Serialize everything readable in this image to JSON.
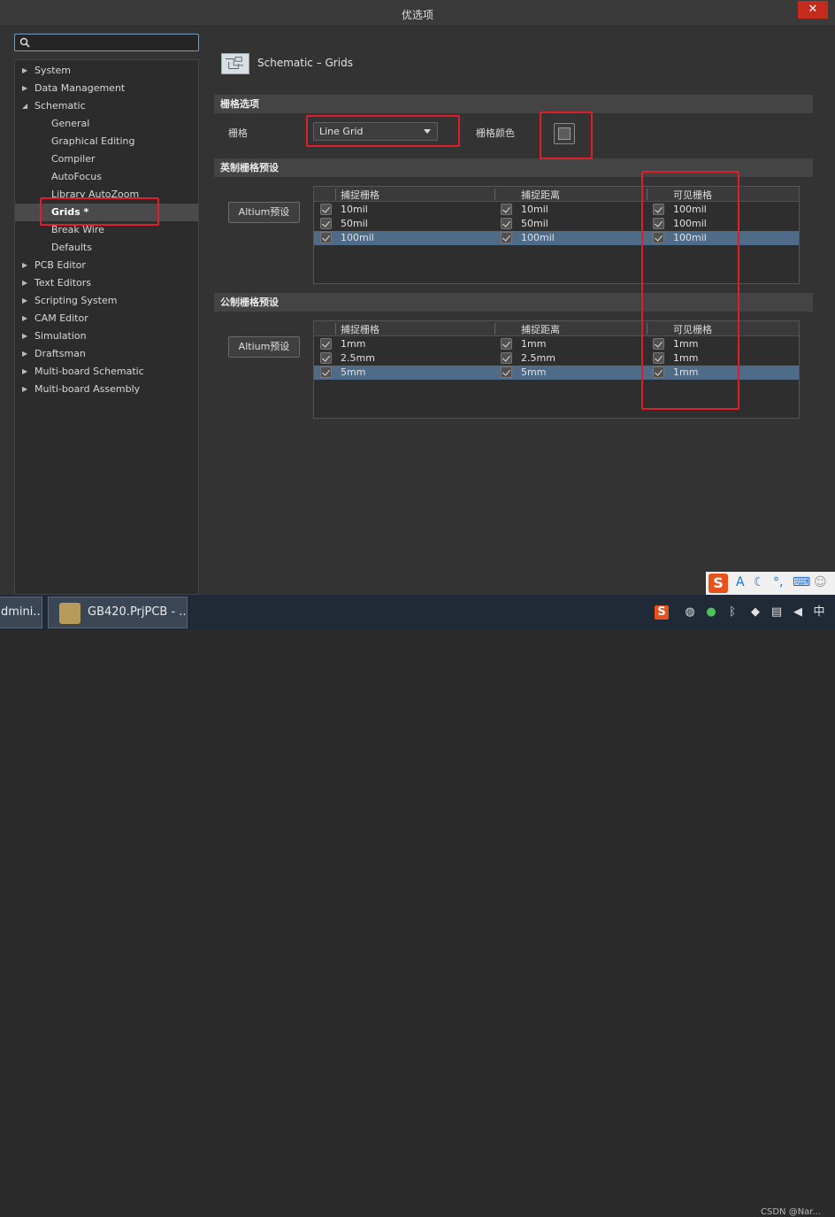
{
  "window": {
    "title": "优选项",
    "close_label": "✕"
  },
  "search": {
    "placeholder": "",
    "value": ""
  },
  "tree": {
    "items": [
      {
        "label": "System",
        "expandable": true
      },
      {
        "label": "Data Management",
        "expandable": true
      },
      {
        "label": "Schematic",
        "expandable": true,
        "expanded": true
      },
      {
        "label": "General"
      },
      {
        "label": "Graphical Editing"
      },
      {
        "label": "Compiler"
      },
      {
        "label": "AutoFocus"
      },
      {
        "label": "Library AutoZoom"
      },
      {
        "label": "Grids *",
        "selected": true
      },
      {
        "label": "Break Wire"
      },
      {
        "label": "Defaults"
      },
      {
        "label": "PCB Editor",
        "expandable": true
      },
      {
        "label": "Text Editors",
        "expandable": true
      },
      {
        "label": "Scripting System",
        "expandable": true
      },
      {
        "label": "CAM Editor",
        "expandable": true
      },
      {
        "label": "Simulation",
        "expandable": true
      },
      {
        "label": "Draftsman",
        "expandable": true
      },
      {
        "label": "Multi-board Schematic",
        "expandable": true
      },
      {
        "label": "Multi-board Assembly",
        "expandable": true
      }
    ]
  },
  "page": {
    "title": "Schematic – Grids"
  },
  "grid_options": {
    "section_title": "栅格选项",
    "grid_label": "栅格",
    "grid_value": "Line Grid",
    "grid_color_label": "栅格颜色"
  },
  "imperial": {
    "section_title": "英制栅格预设",
    "preset_button": "Altium预设",
    "columns": [
      "捕捉栅格",
      "捕捉距离",
      "可见栅格"
    ],
    "rows": [
      [
        "10mil",
        "10mil",
        "100mil"
      ],
      [
        "50mil",
        "50mil",
        "100mil"
      ],
      [
        "100mil",
        "100mil",
        "100mil"
      ]
    ]
  },
  "metric": {
    "section_title": "公制栅格预设",
    "preset_button": "Altium预设",
    "columns": [
      "捕捉栅格",
      "捕捉距离",
      "可见栅格"
    ],
    "rows": [
      [
        "1mm",
        "1mm",
        "1mm"
      ],
      [
        "2.5mm",
        "2.5mm",
        "1mm"
      ],
      [
        "5mm",
        "5mm",
        "1mm"
      ]
    ]
  },
  "taskbar": {
    "item1_label": "dmini...",
    "item2_label": "GB420.PrjPCB - ...",
    "watermark": "CSDN @Nar..."
  },
  "ime": {
    "logo": "S",
    "mode": "A"
  },
  "colors": {
    "accent_selected_row": "#4e6b88",
    "highlight_box": "#e01e2a"
  }
}
